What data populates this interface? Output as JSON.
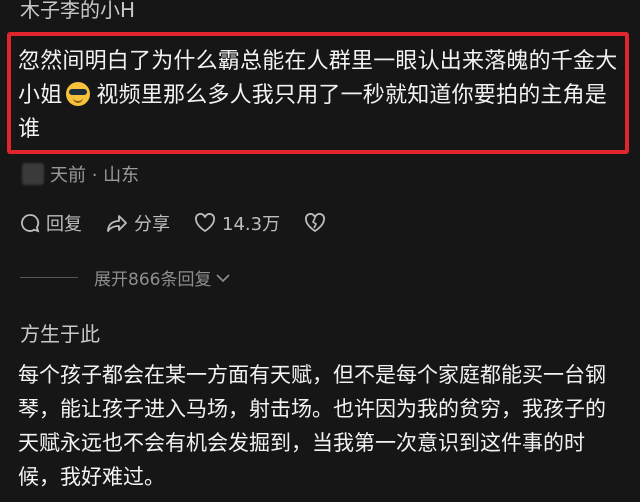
{
  "comment": {
    "username": "木子李的小H",
    "text_before_emoji": "忽然间明白了为什么霸总能在人群里一眼认出来落魄的千金大小姐",
    "emoji": "sunglasses-emoji",
    "text_after_emoji": "视频里那么多人我只用了一秒就知道你要拍的主角是谁",
    "meta": "天前 · 山东",
    "actions": {
      "reply_label": "回复",
      "share_label": "分享",
      "like_count": "14.3万"
    },
    "expand_label": "展开866条回复"
  },
  "reply": {
    "username": "方生于此",
    "text": "每个孩子都会在某一方面有天赋，但不是每个家庭都能买一台钢琴，能让孩子进入马场，射击场。也许因为我的贫穷，我孩子的天赋永远也不会有机会发掘到，当我第一次意识到这件事的时候，我好难过。"
  },
  "colors": {
    "background": "#161616",
    "highlight_border": "#e1252c"
  }
}
